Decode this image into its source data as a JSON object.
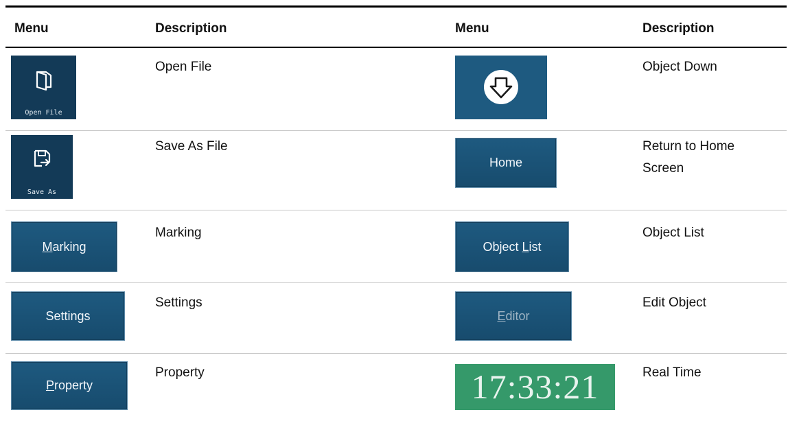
{
  "table": {
    "headers": {
      "menu_left": "Menu",
      "description_left": "Description",
      "menu_right": "Menu",
      "description_right": "Description"
    },
    "rows": [
      {
        "left_button": {
          "label": "Open File",
          "icon": "folder-icon"
        },
        "left_description": "Open File",
        "right_button": {
          "icon": "arrow-down-icon"
        },
        "right_description": "Object Down"
      },
      {
        "left_button": {
          "label": "Save As",
          "icon": "save-as-icon"
        },
        "left_description": "Save As File",
        "right_button": {
          "label": "Home"
        },
        "right_description_line1": "Return to Home",
        "right_description_line2": "Screen"
      },
      {
        "left_button": {
          "mnemonic": "M",
          "rest": "arking"
        },
        "left_description": "Marking",
        "right_button": {
          "prefix": "Object ",
          "mnemonic": "L",
          "rest": "ist"
        },
        "right_description": "Object List"
      },
      {
        "left_button": {
          "label": "Settings"
        },
        "left_description": "Settings",
        "right_button": {
          "mnemonic": "E",
          "rest": "ditor"
        },
        "right_description": "Edit Object"
      },
      {
        "left_button": {
          "mnemonic": "P",
          "rest": "roperty"
        },
        "left_description": "Property",
        "right_clock": "17:33:21",
        "right_description": "Real Time"
      }
    ]
  },
  "colors": {
    "button_blue": "#1e5a80",
    "icon_button_dark": "#133a57",
    "clock_green": "#35996a"
  }
}
